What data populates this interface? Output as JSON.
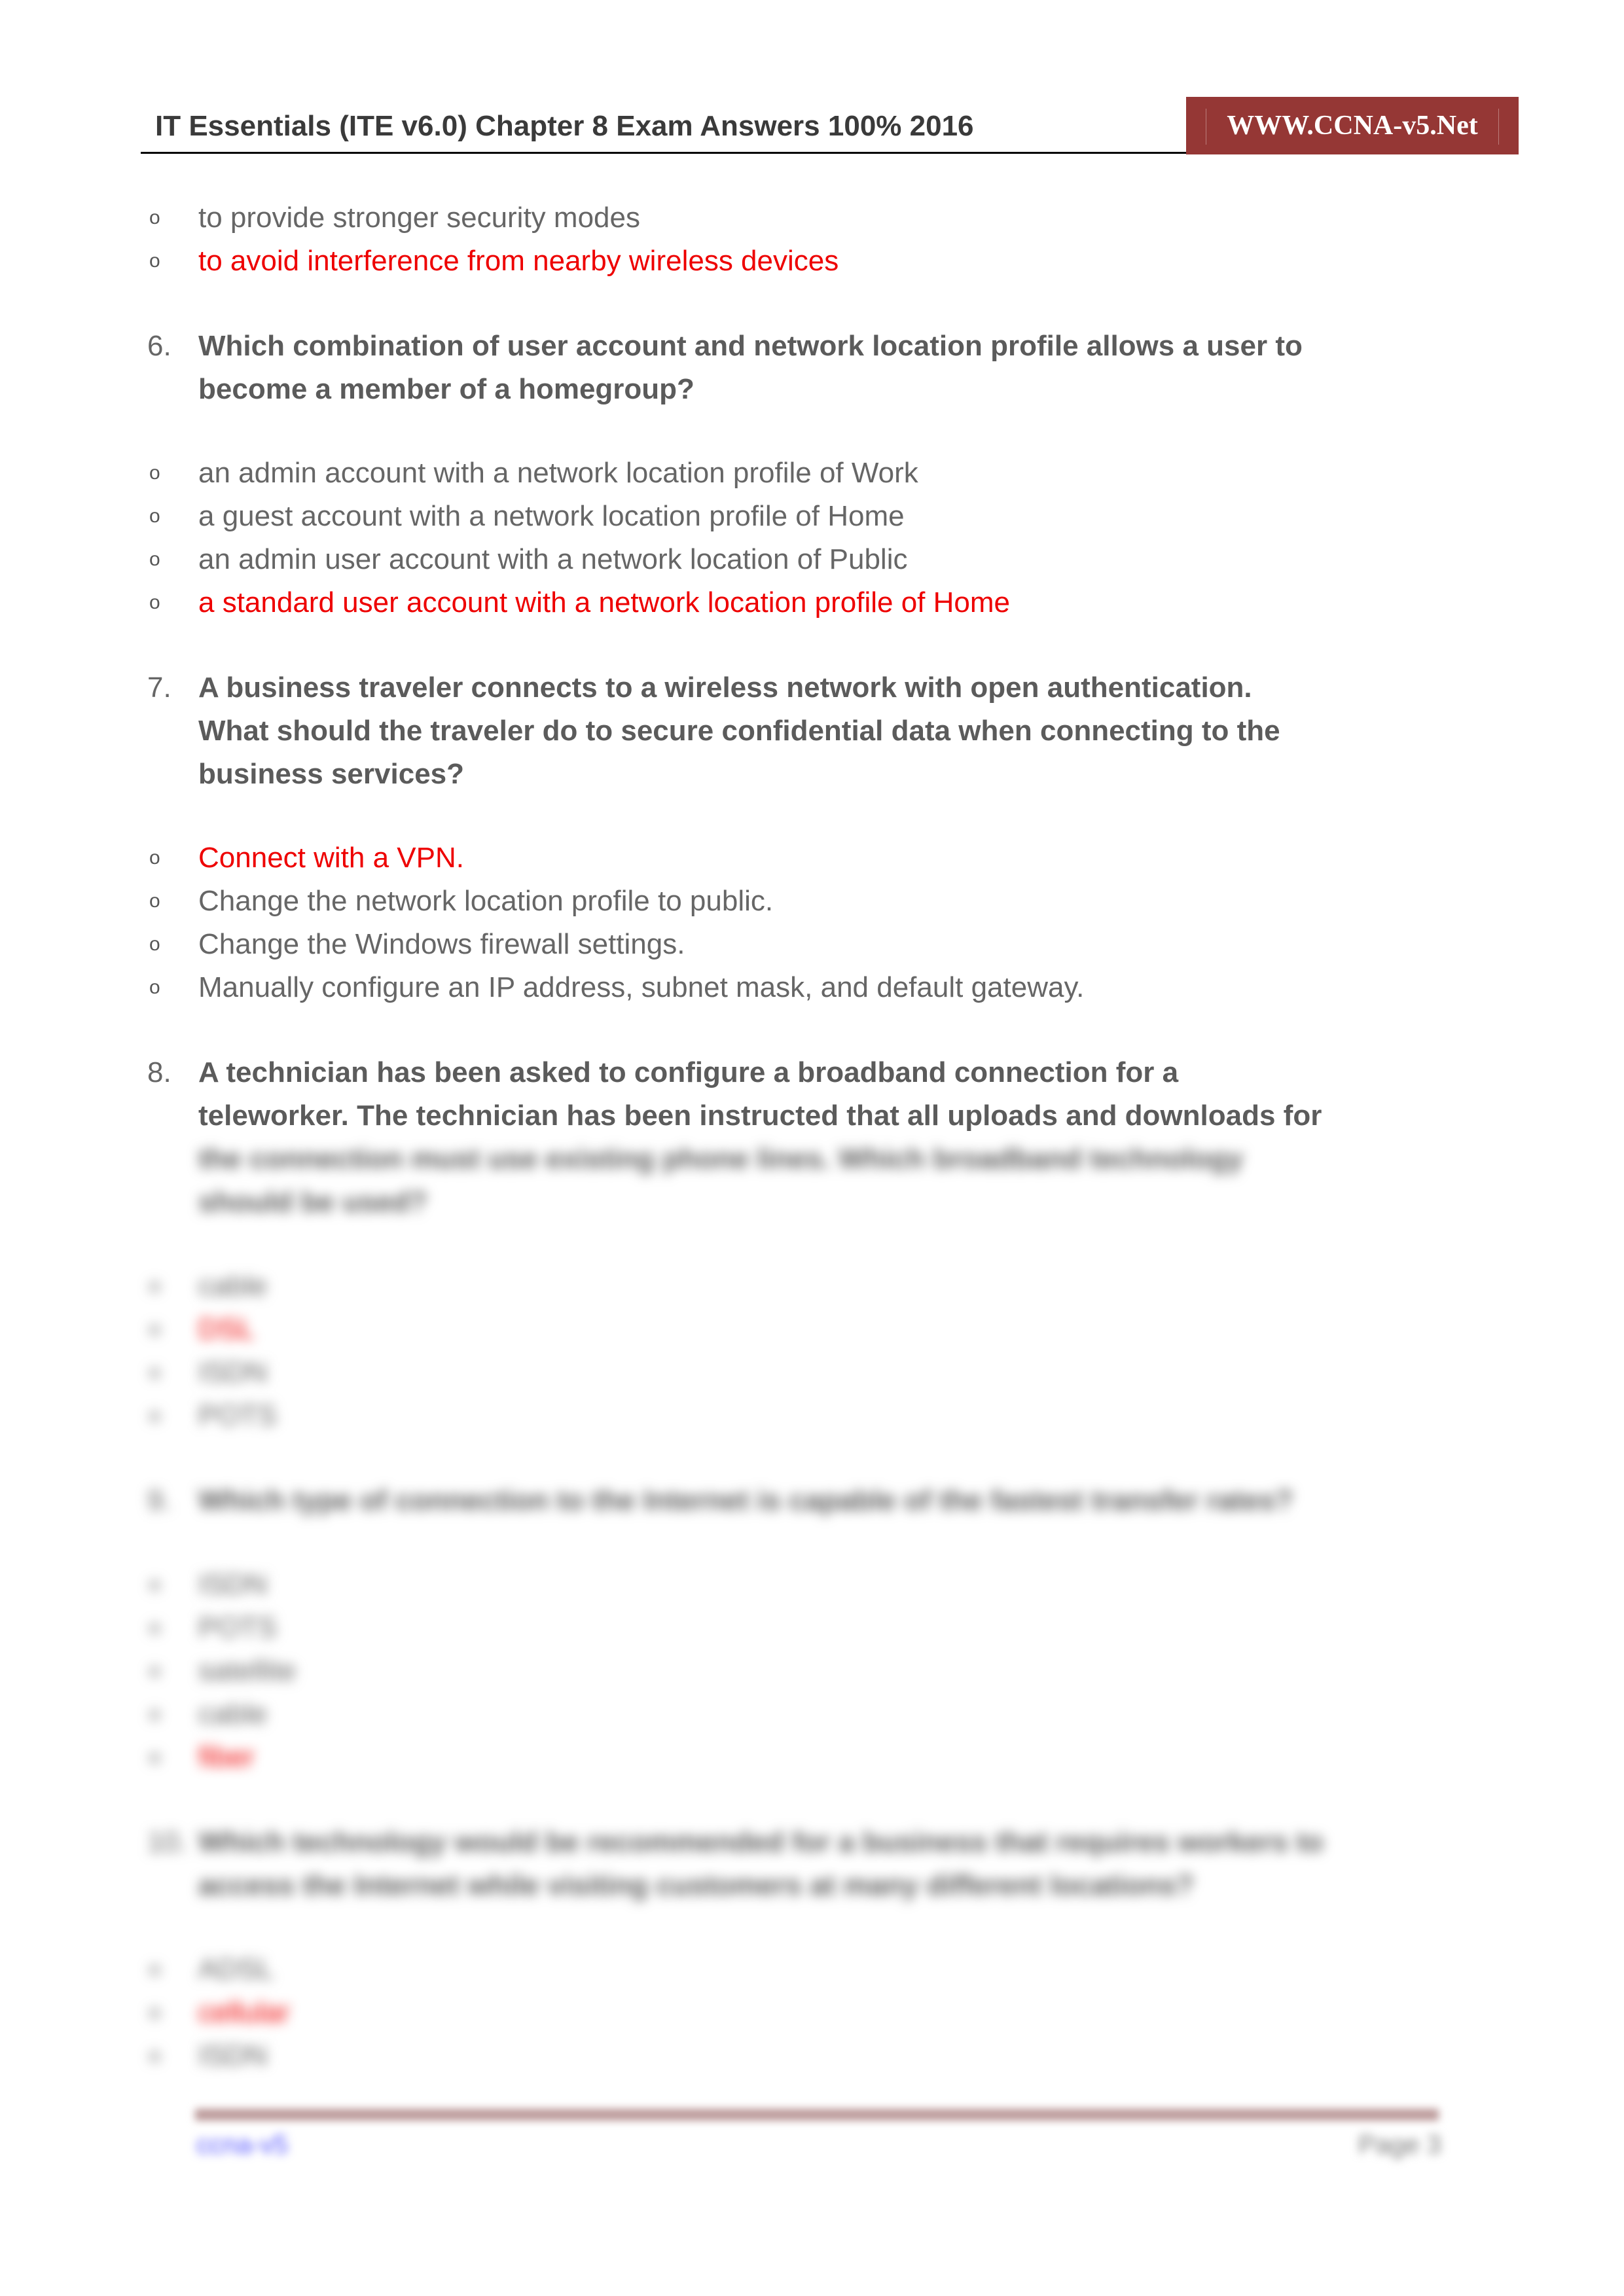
{
  "header": {
    "title": "IT Essentials (ITE v6.0) Chapter 8 Exam Answers 100% 2016",
    "brand": "WWW.CCNA-v5.Net",
    "brand_color": "#953735"
  },
  "colors": {
    "correct": "#ee0000",
    "text": "#666666"
  },
  "bullet_glyph": "o",
  "q5_tail": {
    "options": [
      {
        "text": "to provide stronger security modes",
        "correct": false
      },
      {
        "text": "to avoid interference from nearby wireless devices",
        "correct": true
      }
    ]
  },
  "questions": [
    {
      "number": "6.",
      "lines": [
        "Which combination of user account and network location profile allows a user to",
        "become a member of a homegroup?"
      ],
      "options": [
        {
          "text": "an admin account with a network location profile of Work",
          "correct": false
        },
        {
          "text": "a guest account with a network location profile of Home",
          "correct": false
        },
        {
          "text": "an admin user account with a network location of Public",
          "correct": false
        },
        {
          "text": "a standard user account with a network location profile of Home",
          "correct": true
        }
      ]
    },
    {
      "number": "7.",
      "lines": [
        "A business traveler connects to a wireless network with open authentication.",
        "What should the traveler do to secure confidential data when connecting to the",
        "business services?"
      ],
      "options": [
        {
          "text": "Connect with a VPN.",
          "correct": true
        },
        {
          "text": "Change the network location profile to public.",
          "correct": false
        },
        {
          "text": "Change the Windows firewall settings.",
          "correct": false
        },
        {
          "text": "Manually configure an IP address, subnet mask, and default gateway.",
          "correct": false
        }
      ]
    },
    {
      "number": "8.",
      "lines": [
        "A technician has been asked to configure a broadband connection for a",
        "teleworker. The technician has been instructed that all uploads and downloads for"
      ],
      "blurred_lines": [
        "the connection must use existing phone lines. Which broadband technology",
        "should be used?"
      ],
      "blurred_options": [
        {
          "text": "cable",
          "correct": false
        },
        {
          "text": "DSL",
          "correct": true
        },
        {
          "text": "ISDN",
          "correct": false
        },
        {
          "text": "POTS",
          "correct": false
        }
      ]
    },
    {
      "number": "9.",
      "blurred_lines": [
        "Which type of connection to the Internet is capable of the fastest transfer rates?"
      ],
      "blurred_options": [
        {
          "text": "ISDN",
          "correct": false
        },
        {
          "text": "POTS",
          "correct": false
        },
        {
          "text": "satellite",
          "correct": false
        },
        {
          "text": "cable",
          "correct": false
        },
        {
          "text": "fiber",
          "correct": true
        }
      ]
    },
    {
      "number": "10.",
      "blurred_lines": [
        "Which technology would be recommended for a business that requires workers to",
        "access the Internet while visiting customers at many different locations?"
      ],
      "blurred_options": [
        {
          "text": "ADSL",
          "correct": false
        },
        {
          "text": "cellular",
          "correct": true
        },
        {
          "text": "ISDN",
          "correct": false
        }
      ]
    }
  ],
  "footer": {
    "left": "ccna-v5",
    "right": "Page 3"
  }
}
